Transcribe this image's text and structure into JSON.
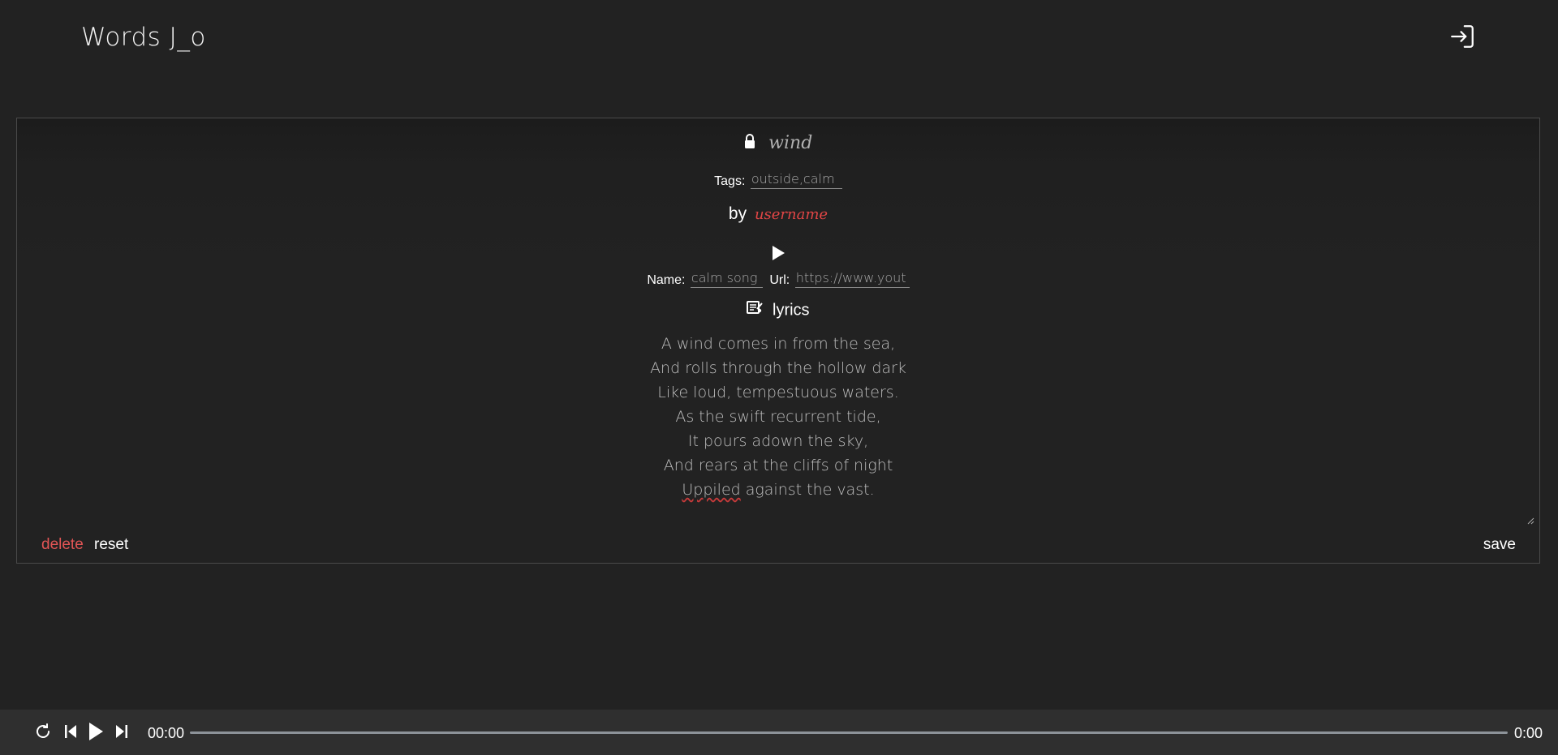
{
  "header": {
    "logo": "Words J_o",
    "login_icon": "sign-in-icon"
  },
  "post": {
    "lock_icon": "lock-icon",
    "title": "wind",
    "tags_label": "Tags:",
    "tags_value": "outside,calm",
    "by_label": "by",
    "username": "username",
    "play_icon": "play-icon",
    "song": {
      "name_label": "Name:",
      "name_value": "calm song",
      "url_label": "Url:",
      "url_value": "https://www.yout"
    },
    "lyrics_icon": "music-note-edit-icon",
    "lyrics_label": "lyrics",
    "lyrics_lines": [
      "A wind comes in from the sea,",
      "And rolls through the hollow dark",
      "Like loud, tempestuous waters.",
      "As the swift recurrent tide,",
      "It pours adown the sky,",
      "And rears at the cliffs of night"
    ],
    "last_line_misspelled": "Uppiled",
    "last_line_rest": " against the vast.",
    "actions": {
      "delete_label": "delete",
      "reset_label": "reset",
      "save_label": "save"
    }
  },
  "player": {
    "current_time": "00:00",
    "total_time": "0:00",
    "progress": 0,
    "icons": [
      "repeat-icon",
      "previous-icon",
      "play-icon",
      "next-icon"
    ]
  },
  "colors": {
    "background": "#222222",
    "accent_red": "#e25555",
    "player_bar": "#2f2f2f"
  }
}
